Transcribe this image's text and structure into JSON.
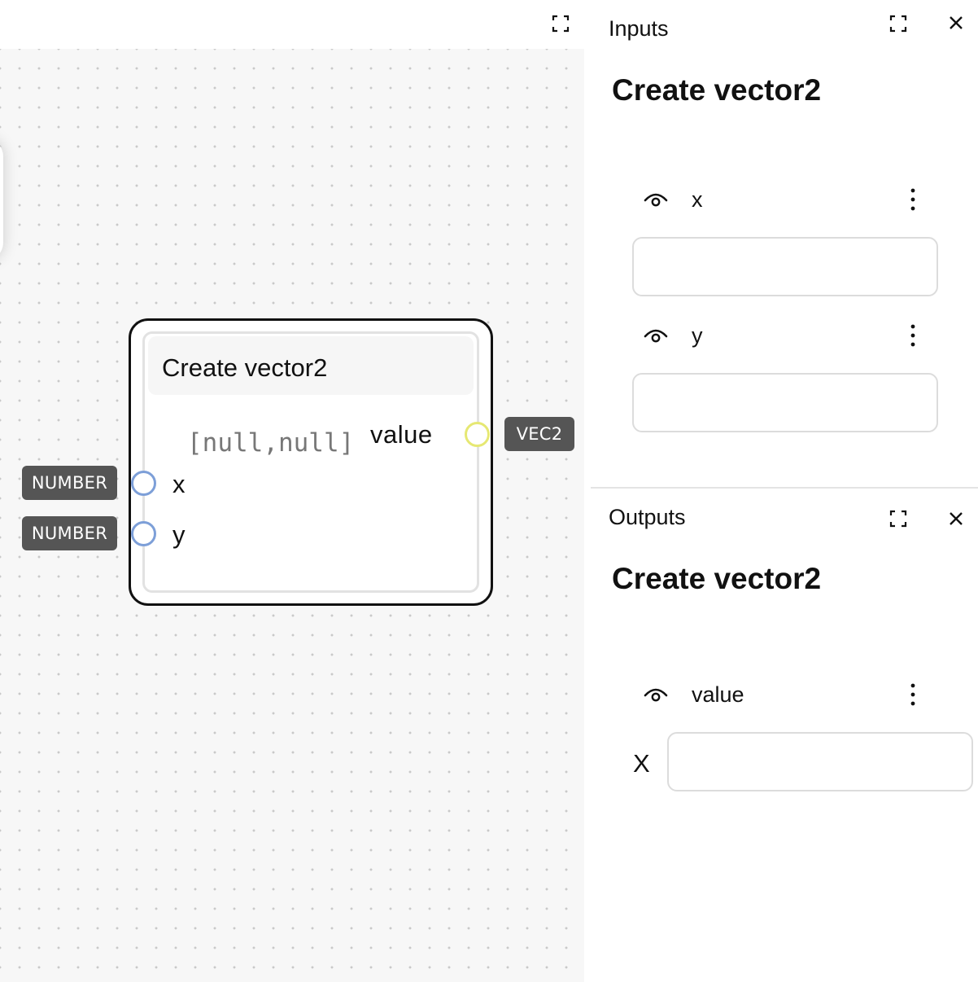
{
  "canvas": {
    "node": {
      "title": "Create vector2",
      "default_value": "[null,null]",
      "output": {
        "label": "value",
        "type": "VEC2"
      },
      "inputs": [
        {
          "label": "x",
          "type": "NUMBER"
        },
        {
          "label": "y",
          "type": "NUMBER"
        }
      ]
    }
  },
  "inputs_panel": {
    "title": "Inputs",
    "heading": "Create vector2",
    "fields": [
      {
        "label": "x",
        "value": ""
      },
      {
        "label": "y",
        "value": ""
      }
    ]
  },
  "outputs_panel": {
    "title": "Outputs",
    "heading": "Create vector2",
    "fields": [
      {
        "label": "value",
        "component_label": "X",
        "value": ""
      }
    ]
  },
  "colors": {
    "input_socket": "#7d9fd8",
    "output_socket": "#e6e873",
    "type_tag": "#555555"
  }
}
